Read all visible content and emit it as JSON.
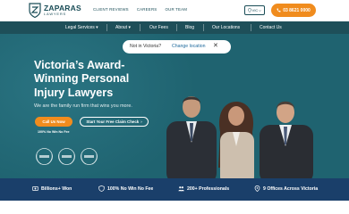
{
  "brand": {
    "name": "ZAPARAS",
    "sub": "LAWYERS"
  },
  "top_links": [
    "CLIENT REVIEWS",
    "CAREERS",
    "OUR TEAM"
  ],
  "location_btn": "VIC",
  "phone": "03 8621 0000",
  "nav": [
    "Legal Services",
    "About",
    "Our Fees",
    "Blog",
    "Our Locations",
    "Contact Us"
  ],
  "popup": {
    "question": "Not in Victoria?",
    "link": "Change location"
  },
  "hero": {
    "headline": [
      "Victoria’s Award-",
      "Winning Personal",
      "Injury Lawyers"
    ],
    "subline": "We are the family run firm that wins you more.",
    "cta_call": "Call Us Now",
    "cta_check": "Start Your Free Claim Check",
    "no_win": "100% No Win No Fee"
  },
  "stats": [
    "Billions+ Won",
    "100% No Win No Fee",
    "200+ Professionals",
    "9 Offices Across Victoria"
  ],
  "colors": {
    "teal": "#1f6370",
    "nav": "#1e4f59",
    "orange": "#f08c1e",
    "navy": "#1a3f6a"
  }
}
